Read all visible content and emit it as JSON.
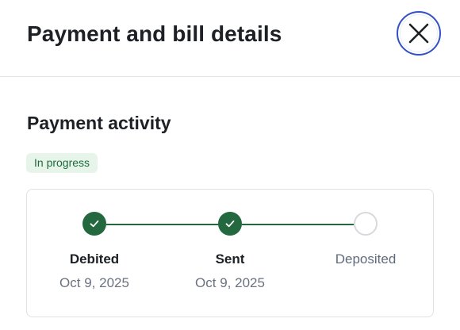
{
  "header": {
    "title": "Payment and bill details",
    "close_icon": "close-icon"
  },
  "payment_activity": {
    "title": "Payment activity",
    "status": "In progress",
    "colors": {
      "complete": "#23683f",
      "badge_background": "#e6f4ea",
      "badge_text": "#1f6a3a",
      "focus_ring": "#3251c5"
    },
    "steps": [
      {
        "label": "Debited",
        "date": "Oct 9, 2025",
        "state": "complete",
        "icon": "check-icon"
      },
      {
        "label": "Sent",
        "date": "Oct 9, 2025",
        "state": "complete",
        "icon": "check-icon"
      },
      {
        "label": "Deposited",
        "date": "",
        "state": "pending",
        "icon": ""
      }
    ]
  }
}
